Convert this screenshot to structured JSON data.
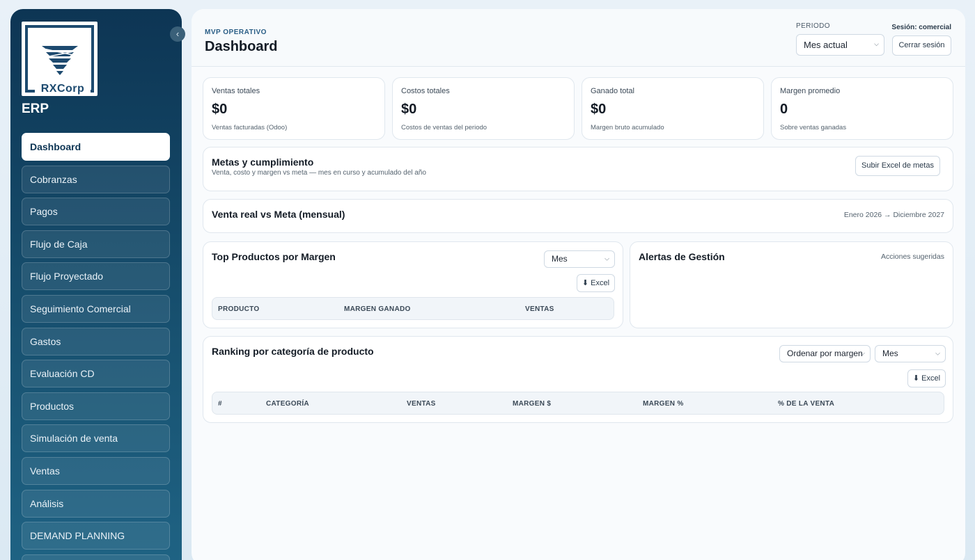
{
  "sidebar": {
    "logo_text": "RXCorp",
    "app_name": "ERP",
    "collapse_icon": "‹",
    "items": [
      {
        "label": "Dashboard",
        "active": true
      },
      {
        "label": "Cobranzas"
      },
      {
        "label": "Pagos"
      },
      {
        "label": "Flujo de Caja"
      },
      {
        "label": "Flujo Proyectado"
      },
      {
        "label": "Seguimiento Comercial"
      },
      {
        "label": "Gastos"
      },
      {
        "label": "Evaluación CD"
      },
      {
        "label": "Productos"
      },
      {
        "label": "Simulación de venta"
      },
      {
        "label": "Ventas"
      },
      {
        "label": "Análisis"
      },
      {
        "label": "DEMAND PLANNING"
      },
      {
        "label": ""
      }
    ]
  },
  "header": {
    "eyebrow": "MVP OPERATIVO",
    "title": "Dashboard",
    "periodo_label": "PERIODO",
    "periodo_value": "Mes actual",
    "session": "Sesión: comercial",
    "logout": "Cerrar sesión"
  },
  "kpis": [
    {
      "label": "Ventas totales",
      "value": "$0",
      "sub": "Ventas facturadas (Odoo)"
    },
    {
      "label": "Costos totales",
      "value": "$0",
      "sub": "Costos de ventas del periodo"
    },
    {
      "label": "Ganado total",
      "value": "$0",
      "sub": "Margen bruto acumulado"
    },
    {
      "label": "Margen promedio",
      "value": "0",
      "sub": "Sobre ventas ganadas"
    }
  ],
  "metas": {
    "title": "Metas y cumplimiento",
    "subtitle": "Venta, costo y margen vs meta — mes en curso y acumulado del año",
    "upload_button": "Subir Excel de metas"
  },
  "venta_meta": {
    "title": "Venta real vs Meta (mensual)",
    "range": "Enero 2026 → Diciembre 2027"
  },
  "top_productos": {
    "title": "Top Productos por Margen",
    "filter": "Mes",
    "excel_button": "⬇ Excel",
    "columns": [
      "PRODUCTO",
      "MARGEN GANADO",
      "VENTAS"
    ],
    "rows": []
  },
  "alertas": {
    "title": "Alertas de Gestión",
    "note": "Acciones sugeridas"
  },
  "ranking": {
    "title": "Ranking por categoría de producto",
    "sort": "Ordenar por margen",
    "filter": "Mes",
    "excel_button": "⬇ Excel",
    "columns": [
      "#",
      "CATEGORÍA",
      "VENTAS",
      "MARGEN $",
      "MARGEN %",
      "% DE LA VENTA"
    ],
    "rows": []
  },
  "colors": {
    "sidebar": "#0d3554",
    "accent": "#2a5e86"
  }
}
